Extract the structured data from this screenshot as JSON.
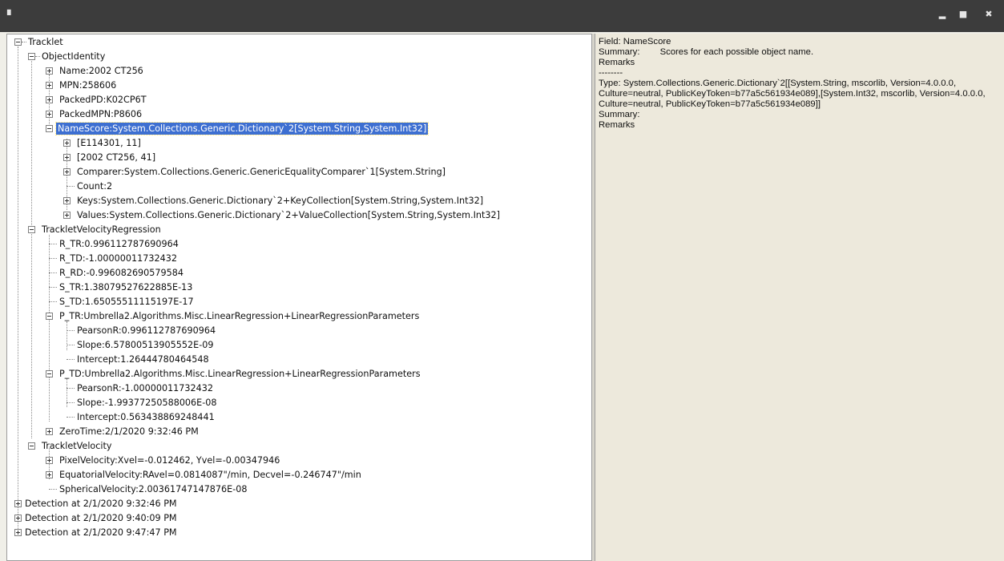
{
  "window": {
    "icon_glyph": "▘",
    "minimize_glyph": "▂",
    "maximize_glyph": "■",
    "close_glyph": "✖"
  },
  "tree": {
    "selected": "NameScore:System.Collections.Generic.Dictionary`2[System.String,System.Int32]",
    "nodes": [
      "Tracklet",
      "ObjectIdentity",
      "Name:2002 CT256",
      "MPN:258606",
      "PackedPD:K02CP6T",
      "PackedMPN:P8606",
      "NameScore:System.Collections.Generic.Dictionary`2[System.String,System.Int32]",
      "[E114301, 11]",
      "[2002 CT256, 41]",
      "Comparer:System.Collections.Generic.GenericEqualityComparer`1[System.String]",
      "Count:2",
      "Keys:System.Collections.Generic.Dictionary`2+KeyCollection[System.String,System.Int32]",
      "Values:System.Collections.Generic.Dictionary`2+ValueCollection[System.String,System.Int32]",
      "TrackletVelocityRegression",
      "R_TR:0.996112787690964",
      "R_TD:-1.00000011732432",
      "R_RD:-0.996082690579584",
      "S_TR:1.38079527622885E-13",
      "S_TD:1.65055511115197E-17",
      "P_TR:Umbrella2.Algorithms.Misc.LinearRegression+LinearRegressionParameters",
      "PearsonR:0.996112787690964",
      "Slope:6.57800513905552E-09",
      "Intercept:1.26444780464548",
      "P_TD:Umbrella2.Algorithms.Misc.LinearRegression+LinearRegressionParameters",
      "PearsonR:-1.00000011732432",
      "Slope:-1.99377250588006E-08",
      "Intercept:0.563438869248441",
      "ZeroTime:2/1/2020 9:32:46 PM",
      "TrackletVelocity",
      "PixelVelocity:Xvel=-0.012462, Yvel=-0.00347946",
      "EquatorialVelocity:RAvel=0.0814087\"/min, Decvel=-0.246747\"/min",
      "SphericalVelocity:2.00361747147876E-08",
      "Detection at 2/1/2020 9:32:46 PM",
      "Detection at 2/1/2020 9:40:09 PM",
      "Detection at 2/1/2020 9:47:47 PM"
    ]
  },
  "info": {
    "text": "Field: NameScore\nSummary:        Scores for each possible object name.\nRemarks\n--------\nType: System.Collections.Generic.Dictionary`2[[System.String, mscorlib, Version=4.0.0.0, Culture=neutral, PublicKeyToken=b77a5c561934e089],[System.Int32, mscorlib, Version=4.0.0.0, Culture=neutral, PublicKeyToken=b77a5c561934e089]]\nSummary:\nRemarks"
  }
}
